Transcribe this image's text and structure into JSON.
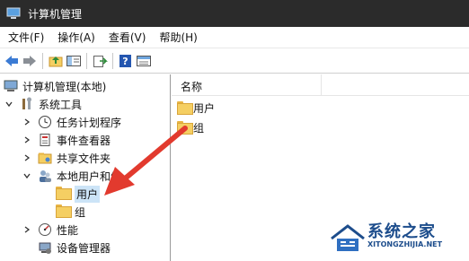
{
  "window": {
    "title": "计算机管理"
  },
  "menu": [
    "文件(F)",
    "操作(A)",
    "查看(V)",
    "帮助(H)"
  ],
  "toolbar": {
    "icons": [
      "back-arrow-icon",
      "forward-arrow-icon",
      "up-folder-icon",
      "show-hide-tree-icon",
      "export-list-icon",
      "help-icon",
      "properties-pane-icon"
    ]
  },
  "tree": {
    "root": "计算机管理(本地)",
    "system_tools": "系统工具",
    "task_scheduler": "任务计划程序",
    "event_viewer": "事件查看器",
    "shared_folders": "共享文件夹",
    "local_users": "本地用户和组",
    "users": "用户",
    "groups": "组",
    "performance": "性能",
    "device_manager": "设备管理器"
  },
  "list": {
    "column_name": "名称",
    "items": [
      "用户",
      "组"
    ]
  },
  "watermark": {
    "text": "系统之家",
    "url": "XITONGZHIJIA.NET"
  },
  "colors": {
    "titlebar": "#2b2b2b",
    "selection": "#cce4f7",
    "folder": "#f5cf63",
    "annotation_arrow": "#e23a2e",
    "watermark": "#1d4d8c"
  }
}
